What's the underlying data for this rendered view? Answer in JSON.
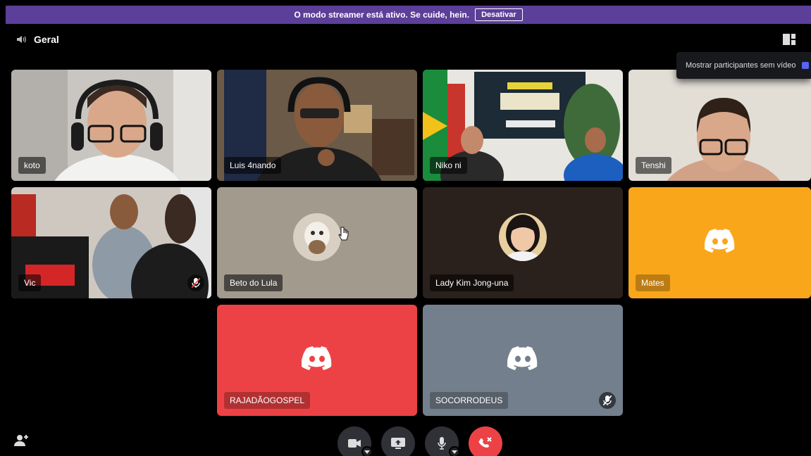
{
  "banner": {
    "message": "O modo streamer está ativo. Se cuide, hein.",
    "action_label": "Desativar"
  },
  "channel": {
    "name": "Geral",
    "icon": "speaker-icon"
  },
  "tooltip": {
    "text": "Mostrar participantes sem vídeo"
  },
  "participants": [
    {
      "name": "koto",
      "video": true,
      "speaking": false,
      "muted": false
    },
    {
      "name": "Luis 4nando",
      "video": true,
      "speaking": true,
      "muted": false
    },
    {
      "name": "Niko ni",
      "video": true,
      "speaking": false,
      "muted": false
    },
    {
      "name": "Tenshi",
      "video": true,
      "speaking": false,
      "muted": false
    },
    {
      "name": "Vic",
      "video": true,
      "speaking": false,
      "muted": true
    },
    {
      "name": "Beto do Lula",
      "video": false,
      "avatar": true,
      "speaking": false,
      "muted": false
    },
    {
      "name": "Lady Kim Jong-una",
      "video": false,
      "avatar": true,
      "speaking": false,
      "muted": false
    },
    {
      "name": "Mates",
      "video": false,
      "color": "#faa61a",
      "speaking": false,
      "muted": false
    },
    {
      "name": "RAJADÃOGOSPEL",
      "video": false,
      "color": "#ed4245",
      "speaking": false,
      "muted": false
    },
    {
      "name": "SOCORRODEUS",
      "video": false,
      "color": "#747f8d",
      "speaking": false,
      "muted": true
    }
  ],
  "colors": {
    "banner": "#5c3f99",
    "speaking_ring": "#3ba55c",
    "end_call": "#ed4245",
    "mates": "#faa61a",
    "rajadao": "#ed4245",
    "socorro": "#747f8d",
    "beto_bg": "#a39a8e",
    "lady_bg": "#2a211c"
  },
  "controls": [
    "camera-icon",
    "screen-share-icon",
    "microphone-icon",
    "end-call-icon"
  ]
}
